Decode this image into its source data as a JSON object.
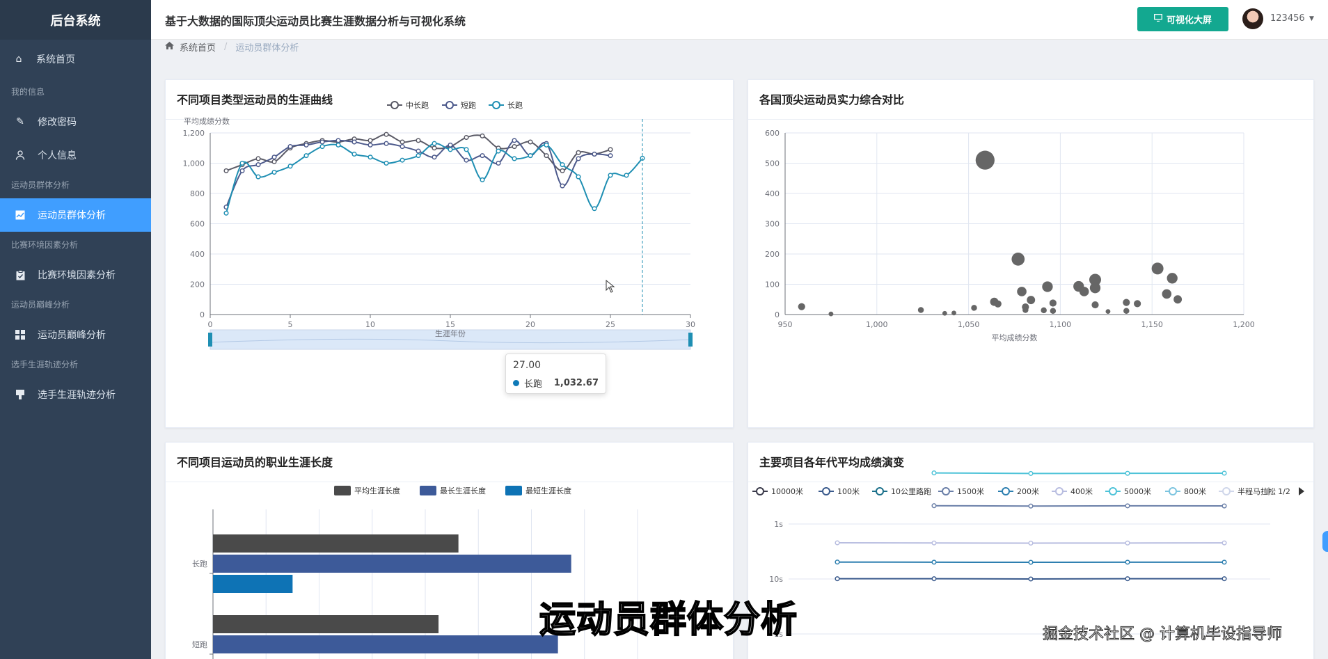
{
  "sidebar": {
    "brand": "后台系统",
    "home": "系统首页",
    "groups": [
      {
        "title": "我的信息",
        "items": [
          "修改密码",
          "个人信息"
        ]
      },
      {
        "title": "运动员群体分析",
        "items": [
          "运动员群体分析"
        ]
      },
      {
        "title": "比赛环境因素分析",
        "items": [
          "比赛环境因素分析"
        ]
      },
      {
        "title": "运动员巅峰分析",
        "items": [
          "运动员巅峰分析"
        ]
      },
      {
        "title": "选手生涯轨迹分析",
        "items": [
          "选手生涯轨迹分析"
        ]
      }
    ],
    "active": "运动员群体分析"
  },
  "header": {
    "title": "基于大数据的国际顶尖运动员比赛生涯数据分析与可视化系统",
    "vis_button": "可视化大屏",
    "username": "123456"
  },
  "breadcrumb": {
    "home": "系统首页",
    "sep": "/",
    "current": "运动员群体分析"
  },
  "cards": {
    "c1": "不同项目类型运动员的生涯曲线",
    "c2": "各国顶尖运动员实力综合对比",
    "c3": "不同项目运动员的职业生涯长度",
    "c4": "主要项目各年代平均成绩演变"
  },
  "tooltip": {
    "x": "27.00",
    "series": "长跑",
    "value": "1,032.67"
  },
  "overlay": {
    "caption": "运动员群体分析",
    "watermark": "掘金技术社区 @ 计算机毕设指导师"
  },
  "chart_data": [
    {
      "type": "line",
      "title": "不同项目类型运动员的生涯曲线",
      "ylabel": "平均成绩分数",
      "xlabel": "生涯年份",
      "xlim": [
        0,
        30
      ],
      "ylim": [
        0,
        1200
      ],
      "colors": {
        "中长跑": "#5a5a66",
        "短跑": "#4d5a8c",
        "长跑": "#1f8fb3"
      },
      "series": [
        {
          "name": "中长跑",
          "x": [
            1,
            2,
            3,
            4,
            5,
            6,
            7,
            8,
            9,
            10,
            11,
            12,
            13,
            14,
            15,
            16,
            17,
            18,
            19,
            20,
            21,
            22,
            23,
            24,
            25
          ],
          "values": [
            950,
            990,
            1030,
            1010,
            1100,
            1130,
            1150,
            1140,
            1160,
            1150,
            1190,
            1140,
            1150,
            1100,
            1110,
            1170,
            1180,
            1100,
            1110,
            1140,
            1050,
            950,
            1070,
            1060,
            1090
          ]
        },
        {
          "name": "短跑",
          "x": [
            1,
            2,
            3,
            4,
            5,
            6,
            7,
            8,
            9,
            10,
            11,
            12,
            13,
            14,
            15,
            16,
            17,
            18,
            19,
            20,
            21,
            22,
            23,
            24,
            25
          ],
          "values": [
            710,
            950,
            990,
            1040,
            1110,
            1120,
            1140,
            1150,
            1140,
            1120,
            1130,
            1110,
            1080,
            1040,
            1120,
            1020,
            1050,
            1000,
            1150,
            1050,
            1130,
            850,
            1030,
            1060,
            1050
          ]
        },
        {
          "name": "长跑",
          "x": [
            1,
            2,
            3,
            4,
            5,
            6,
            7,
            8,
            9,
            10,
            11,
            12,
            13,
            14,
            15,
            16,
            17,
            18,
            19,
            20,
            21,
            22,
            23,
            24,
            25,
            26,
            27
          ],
          "values": [
            670,
            1000,
            910,
            940,
            980,
            1050,
            1110,
            1120,
            1060,
            1040,
            1000,
            1020,
            1050,
            1130,
            1090,
            1090,
            890,
            1080,
            1030,
            1050,
            1120,
            990,
            910,
            700,
            920,
            920,
            1032.67
          ]
        }
      ]
    },
    {
      "type": "scatter",
      "title": "各国顶尖运动员实力综合对比",
      "xlabel": "平均成绩分数",
      "xlim": [
        950,
        1200
      ],
      "ylim": [
        0,
        600
      ],
      "color": "#666666",
      "points": [
        [
          959,
          26,
          6
        ],
        [
          975,
          2,
          4
        ],
        [
          1024,
          15,
          5
        ],
        [
          1037,
          4,
          4
        ],
        [
          1042,
          5,
          4
        ],
        [
          1053,
          22,
          5
        ],
        [
          1059,
          510,
          16
        ],
        [
          1064,
          42,
          7
        ],
        [
          1066,
          35,
          6
        ],
        [
          1077,
          183,
          11
        ],
        [
          1079,
          76,
          8
        ],
        [
          1081,
          25,
          6
        ],
        [
          1081,
          15,
          5
        ],
        [
          1084,
          48,
          7
        ],
        [
          1091,
          14,
          5
        ],
        [
          1093,
          92,
          9
        ],
        [
          1096,
          38,
          6
        ],
        [
          1096,
          12,
          5
        ],
        [
          1110,
          93,
          9
        ],
        [
          1113,
          76,
          8
        ],
        [
          1119,
          115,
          10
        ],
        [
          1119,
          88,
          9
        ],
        [
          1119,
          32,
          6
        ],
        [
          1126,
          10,
          4
        ],
        [
          1136,
          40,
          6
        ],
        [
          1136,
          12,
          5
        ],
        [
          1142,
          36,
          6
        ],
        [
          1153,
          152,
          10
        ],
        [
          1158,
          68,
          8
        ],
        [
          1161,
          120,
          9
        ],
        [
          1164,
          50,
          7
        ]
      ]
    },
    {
      "type": "bar",
      "title": "不同项目运动员的职业生涯长度",
      "orientation": "horizontal",
      "categories": [
        "长跑",
        "短跑"
      ],
      "series": [
        {
          "name": "平均生涯长度",
          "color": "#4a4a4a",
          "values": [
            18.5,
            17
          ]
        },
        {
          "name": "最长生涯长度",
          "color": "#3d5a99",
          "values": [
            27,
            26
          ]
        },
        {
          "name": "最短生涯长度",
          "color": "#0e73b5",
          "values": [
            6,
            0
          ]
        }
      ],
      "xlim": [
        0,
        32
      ]
    },
    {
      "type": "line",
      "title": "主要项目各年代平均成绩演变",
      "y_scale": "log",
      "y_ticks": [
        "1s",
        "10s",
        "1s"
      ],
      "legend": [
        "10000米",
        "100米",
        "10公里路跑",
        "1500米",
        "200米",
        "400米",
        "5000米",
        "800米",
        "半程马拉松"
      ],
      "legend_page": "1/2",
      "series": [
        {
          "name": "100米",
          "color": "#3a5a8c",
          "values": [
            10.1,
            10.1,
            10.0,
            10.1,
            10.1
          ]
        },
        {
          "name": "200米",
          "color": "#2d7fb0",
          "values": [
            20.3,
            20.2,
            20.1,
            20.2,
            20.2
          ]
        },
        {
          "name": "400米",
          "color": "#b8bde0",
          "values": [
            45.5,
            45.2,
            44.9,
            45.1,
            45.3
          ]
        },
        {
          "name": "5000米",
          "color": "#4ec3d8",
          "values": [
            null,
            850,
            830,
            835,
            840
          ]
        },
        {
          "name": "1500米",
          "color": "#6a7fa8",
          "values": [
            null,
            215,
            212,
            214,
            213
          ]
        }
      ]
    }
  ]
}
